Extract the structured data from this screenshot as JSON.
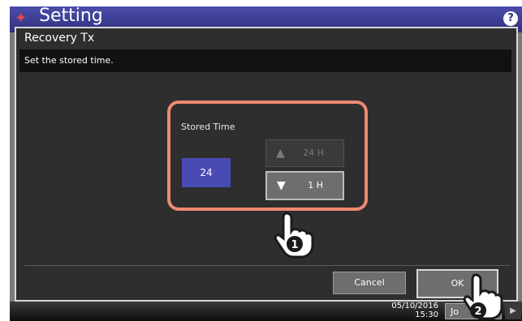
{
  "app": {
    "title": "Setting",
    "help_icon": "?"
  },
  "dialog": {
    "title": "Recovery Tx",
    "message": "Set the stored time.",
    "stored_time_label": "Stored Time",
    "stored_time_value": "24",
    "up_button_label": "24 H",
    "down_button_label": "1 H",
    "cancel_label": "Cancel",
    "ok_label": "OK"
  },
  "status_bar": {
    "date": "05/10/2016",
    "time": "15:30",
    "job_label": "Jo"
  },
  "callouts": {
    "step1": "1",
    "step2": "2"
  },
  "colors": {
    "header": "#2f3180",
    "highlight": "#ef8a72",
    "value_box": "#4a4ab4"
  }
}
